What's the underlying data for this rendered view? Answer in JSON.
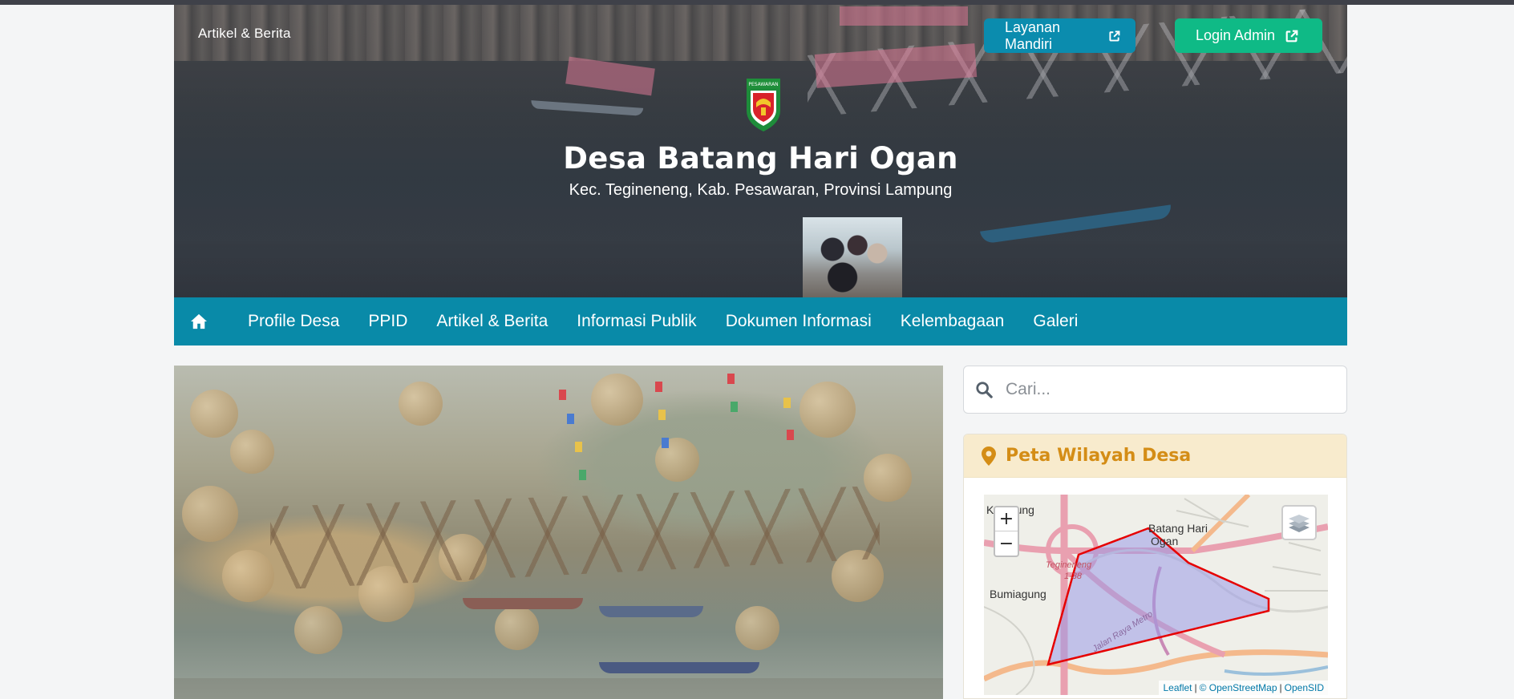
{
  "header": {
    "top_link": "Artikel & Berita",
    "buttons": {
      "layanan": "Layanan Mandiri",
      "login": "Login Admin"
    },
    "logo_text": "PESAWARAN",
    "title": "Desa Batang Hari Ogan",
    "subtitle": "Kec. Tegineneng, Kab. Pesawaran, Provinsi Lampung"
  },
  "nav": {
    "items": [
      "Profile Desa",
      "PPID",
      "Artikel & Berita",
      "Informasi Publik",
      "Dokumen Informasi",
      "Kelembagaan",
      "Galeri"
    ]
  },
  "search": {
    "placeholder": "Cari..."
  },
  "map_widget": {
    "title": "Peta Wilayah Desa",
    "labels": {
      "kotagung": "Kotagung",
      "batang_hari_ogan": "Batang Hari",
      "ogan": "Ogan",
      "tegineneng": "Tegineneng",
      "road_number": "1·38",
      "bumiagung": "Bumiagung",
      "jalan": "Jalan Raya Metro"
    },
    "zoom_in": "+",
    "zoom_out": "−",
    "attribution": {
      "leaflet": "Leaflet",
      "separator": "|",
      "osm": "© OpenStreetMap",
      "opensid": "OpenSID"
    }
  },
  "colors": {
    "nav_bg": "#098aa8",
    "layanan_btn": "#0b8cae",
    "login_btn": "#0fba86",
    "map_title": "#d48d16",
    "map_head_bg": "#f8ebcd",
    "polygon_stroke": "#e60000",
    "polygon_fill": "#9a9ae8"
  },
  "icons": {
    "external": "external-link-icon",
    "home": "home-icon",
    "search": "search-icon",
    "pin": "map-pin-icon",
    "layers": "layers-icon"
  }
}
